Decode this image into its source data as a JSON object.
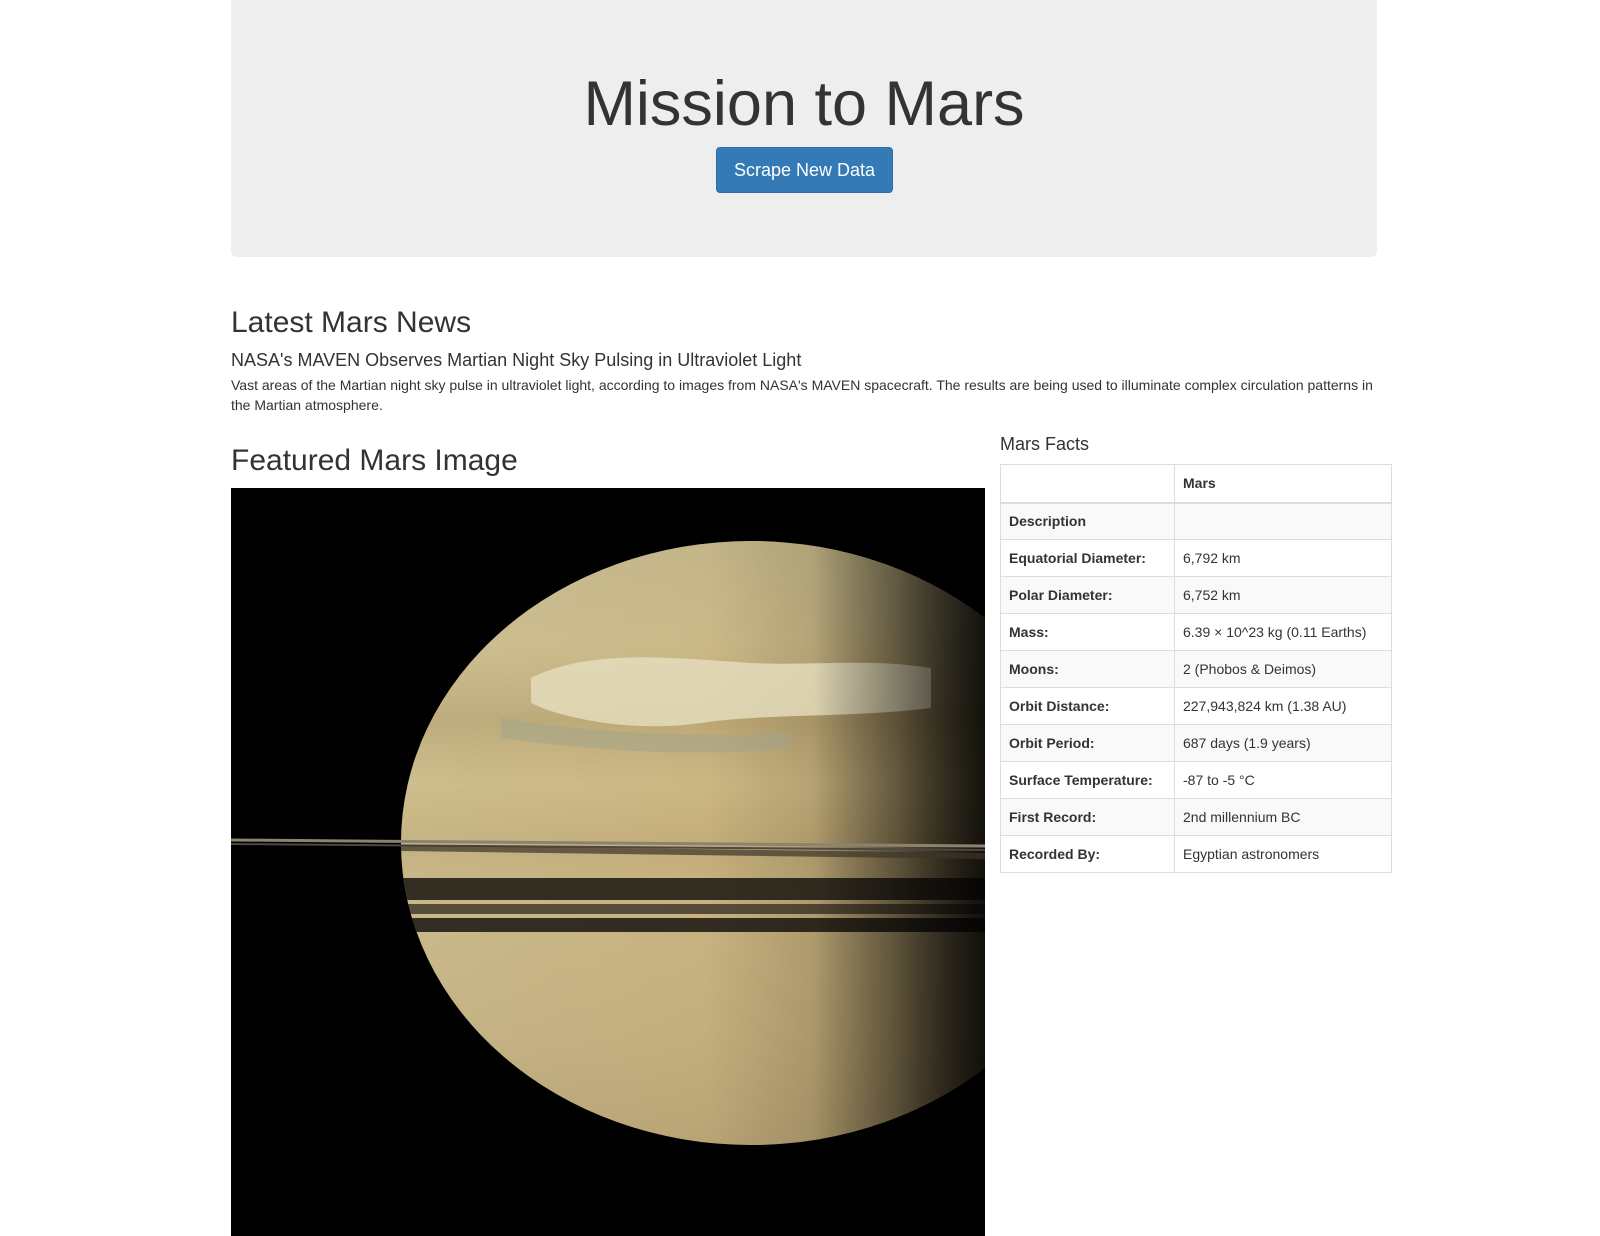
{
  "header": {
    "title": "Mission to Mars",
    "scrape_button_label": "Scrape New Data"
  },
  "news": {
    "heading": "Latest Mars News",
    "title": "NASA's MAVEN Observes Martian Night Sky Pulsing in Ultraviolet Light",
    "body": "Vast areas of the Martian night sky pulse in ultraviolet light, according to images from NASA's MAVEN spacecraft. The results are being used to illuminate complex circulation patterns in the Martian atmosphere."
  },
  "featured_image": {
    "heading": "Featured Mars Image"
  },
  "facts": {
    "heading": "Mars Facts",
    "columns": [
      "",
      "Mars"
    ],
    "rows": [
      {
        "label": "Description",
        "value": ""
      },
      {
        "label": "Equatorial Diameter:",
        "value": "6,792 km"
      },
      {
        "label": "Polar Diameter:",
        "value": "6,752 km"
      },
      {
        "label": "Mass:",
        "value": "6.39 × 10^23 kg (0.11 Earths)"
      },
      {
        "label": "Moons:",
        "value": "2 (Phobos & Deimos)"
      },
      {
        "label": "Orbit Distance:",
        "value": "227,943,824 km (1.38 AU)"
      },
      {
        "label": "Orbit Period:",
        "value": "687 days (1.9 years)"
      },
      {
        "label": "Surface Temperature:",
        "value": "-87 to -5 °C"
      },
      {
        "label": "First Record:",
        "value": "2nd millennium BC"
      },
      {
        "label": "Recorded By:",
        "value": "Egyptian astronomers"
      }
    ]
  }
}
